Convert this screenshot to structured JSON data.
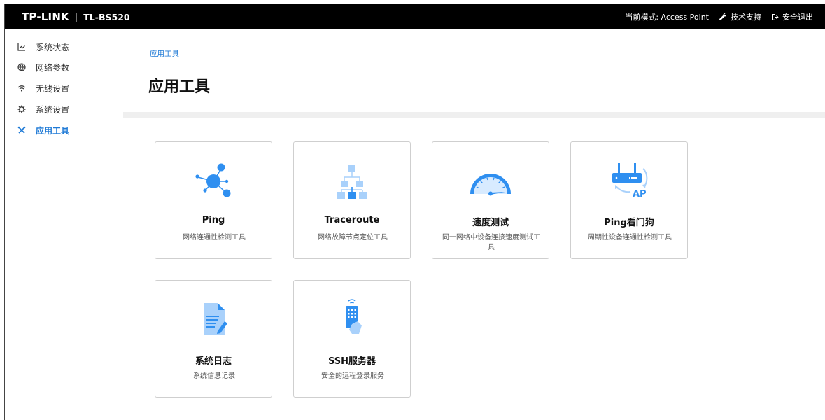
{
  "header": {
    "logo": "TP-LINK",
    "separator": "|",
    "model": "TL-BS520",
    "mode_label": "当前模式: Access Point",
    "support_label": "技术支持",
    "logout_label": "安全退出"
  },
  "sidebar": {
    "items": [
      {
        "label": "系统状态",
        "icon": "status-chart-icon"
      },
      {
        "label": "网络参数",
        "icon": "globe-icon"
      },
      {
        "label": "无线设置",
        "icon": "wifi-icon"
      },
      {
        "label": "系统设置",
        "icon": "gear-icon"
      },
      {
        "label": "应用工具",
        "icon": "tools-icon",
        "active": true
      }
    ]
  },
  "breadcrumb": "应用工具",
  "page_title": "应用工具",
  "tools": [
    {
      "name": "Ping",
      "desc": "网络连通性检测工具",
      "icon": "ping-network-icon"
    },
    {
      "name": "Traceroute",
      "desc": "网络故障节点定位工具",
      "icon": "traceroute-tree-icon"
    },
    {
      "name": "速度测试",
      "desc": "同一网络中设备连接速度测试工具",
      "icon": "speedometer-icon"
    },
    {
      "name": "Ping看门狗",
      "desc": "周期性设备连通性检测工具",
      "icon": "ap-router-icon",
      "badge": "AP"
    },
    {
      "name": "系统日志",
      "desc": "系统信息记录",
      "icon": "log-document-icon"
    },
    {
      "name": "SSH服务器",
      "desc": "安全的远程登录服务",
      "icon": "remote-device-icon"
    }
  ],
  "colors": {
    "accent": "#1f7ad6",
    "icon_blue": "#2f8ff0",
    "icon_light": "#a9d1fb",
    "topbar": "#000000"
  }
}
